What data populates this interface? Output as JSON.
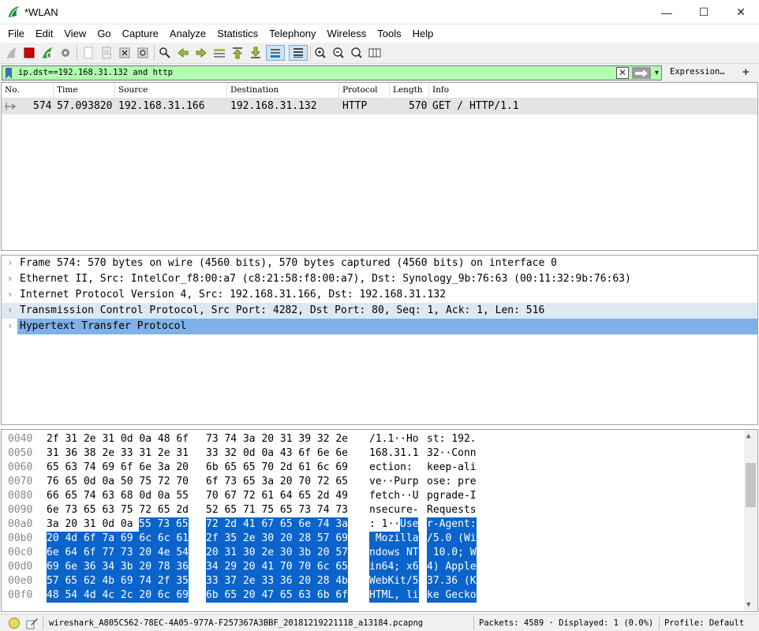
{
  "window": {
    "title": "*WLAN",
    "minimize": "—",
    "maximize": "☐",
    "close": "✕"
  },
  "menu": [
    "File",
    "Edit",
    "View",
    "Go",
    "Capture",
    "Analyze",
    "Statistics",
    "Telephony",
    "Wireless",
    "Tools",
    "Help"
  ],
  "filter": {
    "value": "ip.dst==192.168.31.132 and http",
    "expression_label": "Expression…",
    "add_label": "+"
  },
  "packet_list": {
    "columns": [
      "No.",
      "Time",
      "Source",
      "Destination",
      "Protocol",
      "Length",
      "Info"
    ],
    "rows": [
      {
        "no": "574",
        "time": "57.093820",
        "source": "192.168.31.166",
        "destination": "192.168.31.132",
        "protocol": "HTTP",
        "length": "570",
        "info": "GET / HTTP/1.1"
      }
    ]
  },
  "details": [
    {
      "text": "Frame 574: 570 bytes on wire (4560 bits), 570 bytes captured (4560 bits) on interface 0",
      "state": "normal"
    },
    {
      "text": "Ethernet II, Src: IntelCor_f8:00:a7 (c8:21:58:f8:00:a7), Dst: Synology_9b:76:63 (00:11:32:9b:76:63)",
      "state": "normal"
    },
    {
      "text": "Internet Protocol Version 4, Src: 192.168.31.166, Dst: 192.168.31.132",
      "state": "normal"
    },
    {
      "text": "Transmission Control Protocol, Src Port: 4282, Dst Port: 80, Seq: 1, Ack: 1, Len: 516",
      "state": "light"
    },
    {
      "text": "Hypertext Transfer Protocol",
      "state": "selected"
    }
  ],
  "bytes": [
    {
      "offset": "0040",
      "hex1": "2f 31 2e 31 0d 0a 48 6f",
      "hex2": "73 74 3a 20 31 39 32 2e",
      "asc1": "/1.1··Ho",
      "asc2": "st: 192.",
      "sel_from": -1
    },
    {
      "offset": "0050",
      "hex1": "31 36 38 2e 33 31 2e 31",
      "hex2": "33 32 0d 0a 43 6f 6e 6e",
      "asc1": "168.31.1",
      "asc2": "32··Conn",
      "sel_from": -1
    },
    {
      "offset": "0060",
      "hex1": "65 63 74 69 6f 6e 3a 20",
      "hex2": "6b 65 65 70 2d 61 6c 69",
      "asc1": "ection: ",
      "asc2": "keep-ali",
      "sel_from": -1
    },
    {
      "offset": "0070",
      "hex1": "76 65 0d 0a 50 75 72 70",
      "hex2": "6f 73 65 3a 20 70 72 65",
      "asc1": "ve··Purp",
      "asc2": "ose: pre",
      "sel_from": -1
    },
    {
      "offset": "0080",
      "hex1": "66 65 74 63 68 0d 0a 55",
      "hex2": "70 67 72 61 64 65 2d 49",
      "asc1": "fetch··U",
      "asc2": "pgrade-I",
      "sel_from": -1
    },
    {
      "offset": "0090",
      "hex1": "6e 73 65 63 75 72 65 2d",
      "hex2": "52 65 71 75 65 73 74 73",
      "asc1": "nsecure-",
      "asc2": "Requests",
      "sel_from": -1
    },
    {
      "offset": "00a0",
      "hex1": "3a 20 31 0d 0a ",
      "hex1_sel": "55 73 65",
      "hex2": "72 2d 41 67 65 6e 74 3a",
      "asc1": ": 1··",
      "asc1_sel": "Use",
      "asc2": "r-Agent:",
      "sel_from": 5
    },
    {
      "offset": "00b0",
      "hex1": "",
      "hex1_sel": "20 4d 6f 7a 69 6c 6c 61",
      "hex2": "2f 35 2e 30 20 28 57 69",
      "asc1": "",
      "asc1_sel": " Mozilla",
      "asc2": "/5.0 (Wi",
      "sel_from": 0
    },
    {
      "offset": "00c0",
      "hex1": "",
      "hex1_sel": "6e 64 6f 77 73 20 4e 54",
      "hex2": "20 31 30 2e 30 3b 20 57",
      "asc1": "",
      "asc1_sel": "ndows NT",
      "asc2": " 10.0; W",
      "sel_from": 0
    },
    {
      "offset": "00d0",
      "hex1": "",
      "hex1_sel": "69 6e 36 34 3b 20 78 36",
      "hex2": "34 29 20 41 70 70 6c 65",
      "asc1": "",
      "asc1_sel": "in64; x6",
      "asc2": "4) Apple",
      "sel_from": 0
    },
    {
      "offset": "00e0",
      "hex1": "",
      "hex1_sel": "57 65 62 4b 69 74 2f 35",
      "hex2": "33 37 2e 33 36 20 28 4b",
      "asc1": "",
      "asc1_sel": "WebKit/5",
      "asc2": "37.36 (K",
      "sel_from": 0
    },
    {
      "offset": "00f0",
      "hex1": "",
      "hex1_sel": "48 54 4d 4c 2c 20 6c 69",
      "hex2": "6b 65 20 47 65 63 6b 6f",
      "asc1": "",
      "asc1_sel": "HTML, li",
      "asc2": "ke Gecko",
      "sel_from": 0
    }
  ],
  "status": {
    "file": "wireshark_A805C562-78EC-4A05-977A-F257367A3BBF_20181219221118_a13184.pcapng",
    "packets": "Packets: 4589 · Displayed: 1 (0.0%)",
    "profile": "Profile: Default"
  },
  "colors": {
    "filter_valid": "#afffaf",
    "selection": "#0b64cc",
    "selected_tree_row": "#7fb1e8",
    "related_tree_row": "#dde8f3",
    "packet_row": "#e4e4e4"
  }
}
